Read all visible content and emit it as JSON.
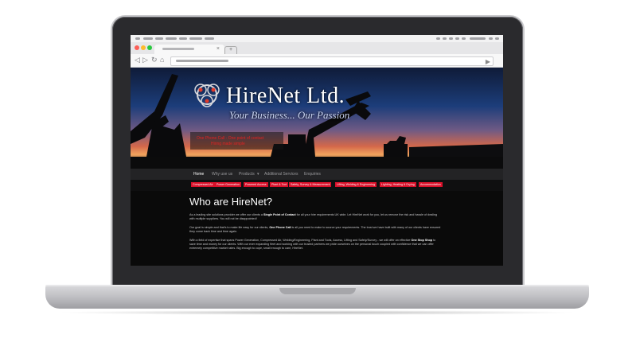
{
  "site": {
    "logo_text": "HireNet Ltd.",
    "tagline": "Your Business... Our Passion",
    "promo_line1": "One Phone Call - One point of contact",
    "promo_line2": "Hiring made simple"
  },
  "nav": {
    "items": [
      "Home",
      "Why use us",
      "Products",
      "Additional Services",
      "Enquiries"
    ],
    "products_caret": "▾"
  },
  "categories": [
    "Compressed Air",
    "Power Generation",
    "Powered Access",
    "Plant & Tool",
    "Safety, Survey & Measurement",
    "Lifting, Welding & Engineering",
    "Lighting, Heating & Drying",
    "Accommodation"
  ],
  "content": {
    "heading": "Who are HireNet?",
    "p1_a": "As a leading site solutions provider we offer our clients a ",
    "p1_b": "Single Point of Contact",
    "p1_c": " for all your hire requirements UK wide. Let HireNet work for you, let us remove the risk and hassle of dealing with multiple suppliers. You will not be disappointed!",
    "p2_a": "Our goal is simple and that's to make life easy for our clients, ",
    "p2_b": "One Phone Call",
    "p2_c": " is all you need to make to source your requirements. The trust we have built with many of our clients have ensured they come back time and time again.",
    "p3_a": "With a field of expertise that spans Power Generation, Compressed Air, Welding/Engineering, Plant and Tools, Access, Lifting and Safety/Survey - we will offer an effective ",
    "p3_b": "One Stop Shop",
    "p3_c": " to save time and money for our clients. With our ever expanding fleet and working with our trusted partners we pride ourselves on the personal touch coupled with confidence that we can offer extremely competitive market rates. Big enough to cope, small enough to care, HireNet."
  },
  "browser": {
    "tab_close": "×",
    "new_tab": "+",
    "back": "◁",
    "forward": "▷",
    "reload": "↻",
    "home": "⌂",
    "go": "▶"
  },
  "colors": {
    "accent_red": "#d9102a",
    "laptop_frame": "#2a2a2d",
    "nav_bg": "#232325"
  },
  "icons": [
    "close-icon",
    "plus-icon",
    "back-arrow-icon",
    "forward-arrow-icon",
    "reload-icon",
    "home-icon",
    "go-icon",
    "logo-icon"
  ]
}
